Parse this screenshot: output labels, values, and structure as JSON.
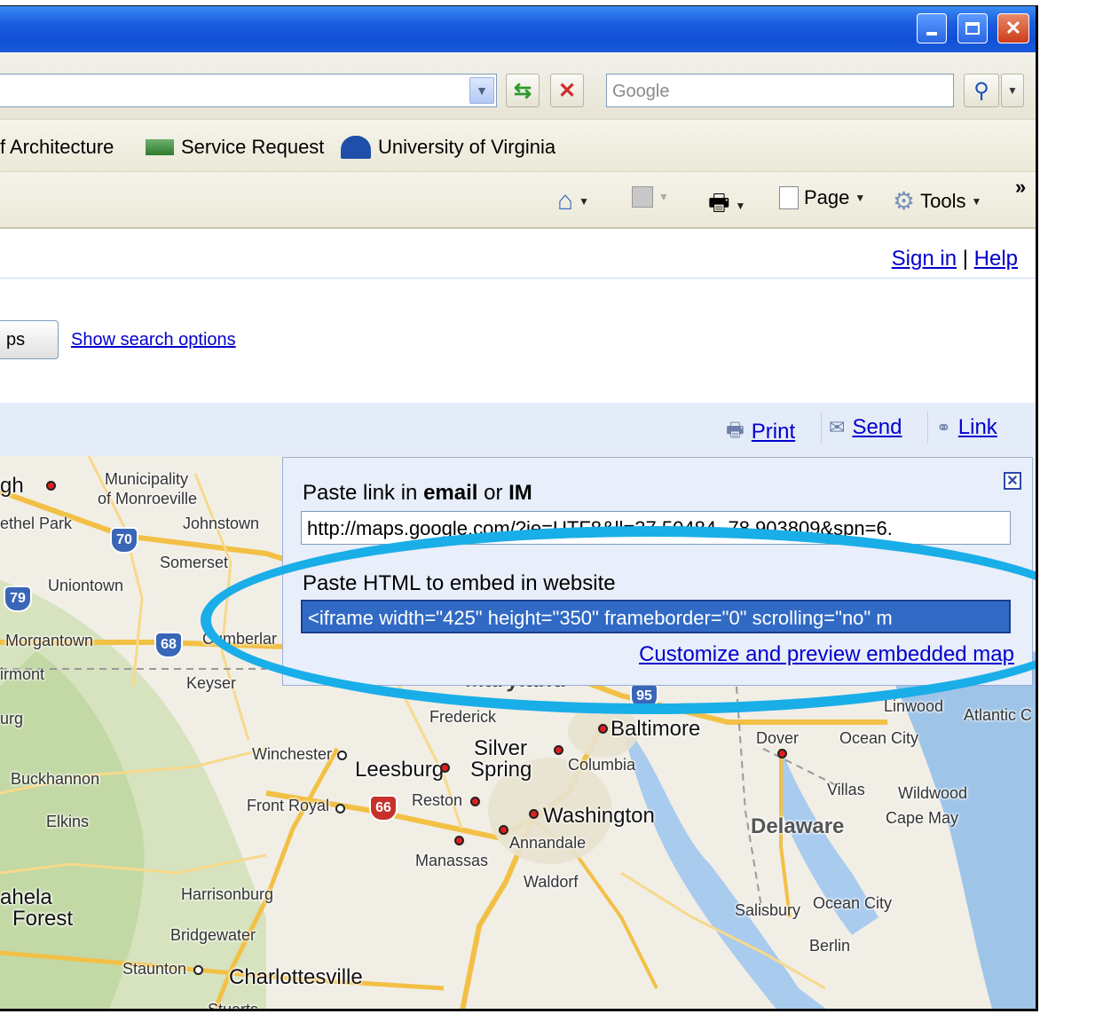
{
  "toolbar": {
    "search_placeholder": "Google",
    "links": [
      "f Architecture",
      "Service Request",
      "University of Virginia"
    ],
    "page_label": "Page",
    "tools_label": "Tools",
    "chevron": "»"
  },
  "header": {
    "sign_in": "Sign in",
    "separator": "|",
    "help": "Help"
  },
  "search": {
    "maps_button_partial": "ps",
    "show_options": "Show search options"
  },
  "actions": {
    "print": "Print",
    "send": "Send",
    "link": "Link"
  },
  "popup": {
    "email_label_pre": "Paste link in ",
    "email_label_b1": "email",
    "email_label_mid": " or ",
    "email_label_b2": "IM",
    "link_value": "http://maps.google.com/?ie=UTF8&ll=37.50484,-78.903809&spn=6.",
    "embed_label": "Paste HTML to embed in website",
    "embed_value": "<iframe width=\"425\" height=\"350\" frameborder=\"0\" scrolling=\"no\" m",
    "customize": "Customize and preview embedded map"
  },
  "map": {
    "places": [
      "gh",
      "Municipality",
      "of Monroeville",
      "ethel Park",
      "Johnstown",
      "Somerset",
      "Uniontown",
      "Morgantown",
      "Cumberlar",
      "irmont",
      "Keyser",
      "urg",
      "Frederick",
      "Baltimore",
      "Silver",
      "Spring",
      "Columbia",
      "Winchester",
      "Leesburg",
      "Buckhannon",
      "Reston",
      "Washington",
      "Front Royal",
      "Elkins",
      "Annandale",
      "Manassas",
      "Waldorf",
      "Dover",
      "Ocean City",
      "Villas",
      "Wildwood",
      "Cape May",
      "Delaware",
      "Atlantic C",
      "Linwood",
      "ahela",
      "Forest",
      "Harrisonburg",
      "Bridgewater",
      "Salisbury",
      "Ocean City",
      "Berlin",
      "Staunton",
      "Charlottesville",
      "Stuarts",
      "Maryland"
    ],
    "shields": [
      "70",
      "79",
      "68",
      "66",
      "95"
    ]
  },
  "colors": {
    "accent_ring": "#19aee8",
    "link": "#0000cc",
    "selection": "#316ac5"
  }
}
